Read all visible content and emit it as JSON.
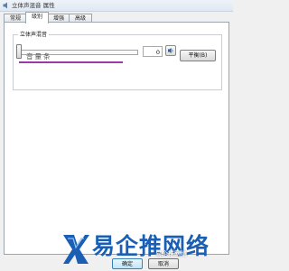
{
  "window": {
    "title": "立体声混音 属性"
  },
  "tabs": [
    "常规",
    "级别",
    "增强",
    "高级"
  ],
  "levels": {
    "group_label": "立体声混音",
    "slider_annotation": "音量条",
    "volume_value": "0",
    "volume_level": 0,
    "balance_label": "平衡(B)"
  },
  "footer": {
    "ok_label": "确定",
    "cancel_label": "取消"
  },
  "watermark": {
    "brand_text": "易企推网络",
    "overlay_text": "易企推网络"
  },
  "icons": {
    "window": "sound-icon",
    "speaker": "speaker-icon",
    "logo": "brand-logo-icon"
  },
  "colors": {
    "annotation_underline": "#9a3aa4",
    "watermark": "#1a5fb4",
    "ok_border": "#3c7fb1"
  }
}
